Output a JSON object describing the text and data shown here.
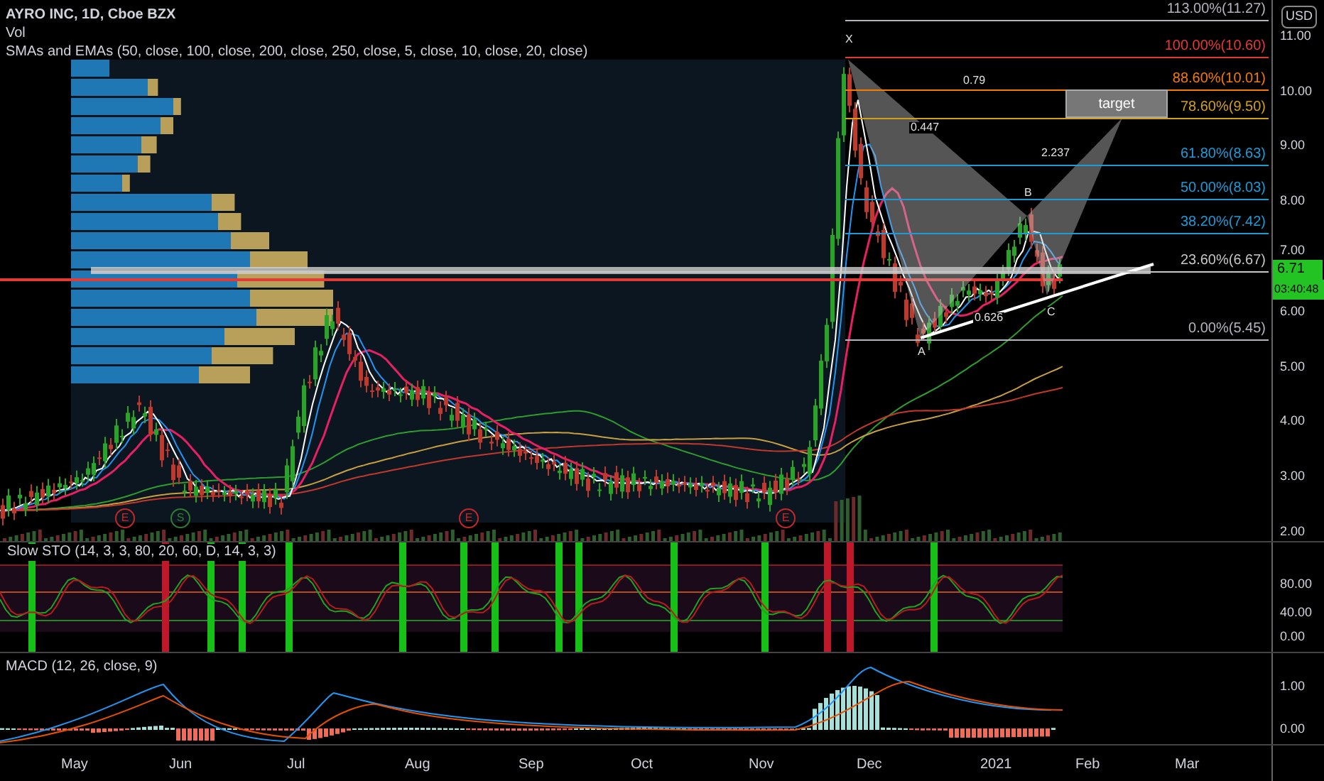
{
  "symbol_title": "AYRO INC, 1D, Cboe BZX",
  "legend": [
    "Vol",
    "SMAs and EMAs (50, close, 100, close, 200, close, 250, close, 5, close, 10, close, 20, close)"
  ],
  "currency": "USD",
  "price_axis": [
    "11.00",
    "10.00",
    "9.00",
    "8.00",
    "7.00",
    "6.00",
    "5.00",
    "4.00",
    "3.00",
    "2.00"
  ],
  "last_price": "6.71",
  "countdown": "03:40:48",
  "fib_levels": [
    {
      "label": "113.00%(11.27)",
      "color": "#b2b5be"
    },
    {
      "label": "100.00%(10.60)",
      "color": "#e53935"
    },
    {
      "label": "88.60%(10.01)",
      "color": "#f57c00"
    },
    {
      "label": "78.60%(9.50)",
      "color": "#d4a017"
    },
    {
      "label": "61.80%(8.63)",
      "color": "#1e9bd7"
    },
    {
      "label": "50.00%(8.03)",
      "color": "#1e9bd7"
    },
    {
      "label": "38.20%(7.42)",
      "color": "#1e9bd7"
    },
    {
      "label": "23.60%(6.67)",
      "color": "#c7c7c7"
    },
    {
      "label": "0.00%(5.45)",
      "color": "#b2b5be"
    }
  ],
  "pattern": {
    "points": [
      "X",
      "A",
      "B",
      "C"
    ],
    "ratios": [
      "0.79",
      "0.447",
      "2.237",
      "0.626"
    ],
    "target": "target"
  },
  "events": [
    {
      "letter": "E",
      "kind": "earnings"
    },
    {
      "letter": "S",
      "kind": "split"
    },
    {
      "letter": "E",
      "kind": "earnings"
    },
    {
      "letter": "E",
      "kind": "earnings"
    }
  ],
  "stochastic": {
    "title": "Slow STO (14, 3, 3, 80, 20, 60, D, 14, 3, 3)",
    "axis": [
      "80.00",
      "40.00",
      "0.00"
    ]
  },
  "macd": {
    "title": "MACD (12, 26, close, 9)",
    "axis": [
      "1.00",
      "0.00"
    ]
  },
  "time_axis": [
    "May",
    "Jun",
    "Jul",
    "Aug",
    "Sep",
    "Oct",
    "Nov",
    "Dec",
    "2021",
    "Feb",
    "Mar"
  ]
}
